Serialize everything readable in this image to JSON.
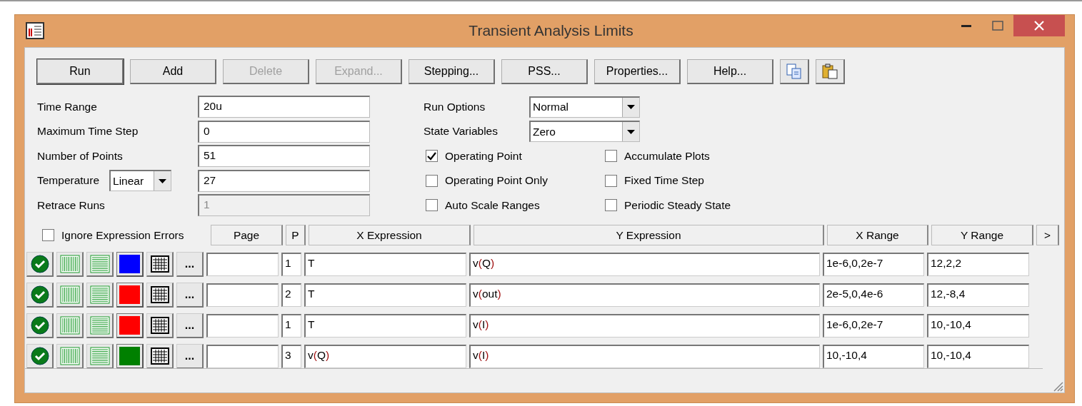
{
  "window": {
    "title": "Transient Analysis Limits"
  },
  "buttons": [
    {
      "label": "Run",
      "disabled": false,
      "default": true
    },
    {
      "label": "Add",
      "disabled": false,
      "default": false
    },
    {
      "label": "Delete",
      "disabled": true,
      "default": false
    },
    {
      "label": "Expand...",
      "disabled": true,
      "default": false
    },
    {
      "label": "Stepping...",
      "disabled": false,
      "default": false
    },
    {
      "label": "PSS...",
      "disabled": false,
      "default": false
    },
    {
      "label": "Properties...",
      "disabled": false,
      "default": false
    },
    {
      "label": "Help...",
      "disabled": false,
      "default": false
    }
  ],
  "fields": [
    {
      "label": "Time Range",
      "value": "20u",
      "disabled": false
    },
    {
      "label": "Maximum Time Step",
      "value": "0",
      "disabled": false
    },
    {
      "label": "Number of Points",
      "value": "51",
      "disabled": false
    },
    {
      "label": "Temperature",
      "value": "27",
      "disabled": false,
      "mode": "Linear"
    },
    {
      "label": "Retrace Runs",
      "value": "1",
      "disabled": true
    }
  ],
  "dropdowns": [
    {
      "label": "Run Options",
      "value": "Normal"
    },
    {
      "label": "State Variables",
      "value": "Zero"
    }
  ],
  "options": [
    {
      "label": "Operating Point",
      "checked": true
    },
    {
      "label": "Accumulate Plots",
      "checked": false
    },
    {
      "label": "Operating Point Only",
      "checked": false
    },
    {
      "label": "Fixed Time Step",
      "checked": false
    },
    {
      "label": "Auto Scale Ranges",
      "checked": false
    },
    {
      "label": "Periodic Steady State",
      "checked": false
    }
  ],
  "ignore_expression_errors": {
    "label": "Ignore Expression Errors",
    "checked": false
  },
  "table": {
    "columns": [
      "Page",
      "P",
      "X Expression",
      "Y Expression",
      "X Range",
      "Y Range"
    ],
    "more": ">",
    "rows": [
      {
        "color": "#0000ff",
        "page_button": "...",
        "p": "1",
        "x_expression": "T",
        "y_expression": "v(Q)",
        "x_range": "1e-6,0,2e-7",
        "y_range": "12,2,2"
      },
      {
        "color": "#ff0000",
        "page_button": "...",
        "p": "2",
        "x_expression": "T",
        "y_expression": "v(out)",
        "x_range": "2e-5,0,4e-6",
        "y_range": "12,-8,4"
      },
      {
        "color": "#ff0000",
        "page_button": "...",
        "p": "1",
        "x_expression": "T",
        "y_expression": "v(I)",
        "x_range": "1e-6,0,2e-7",
        "y_range": "10,-10,4"
      },
      {
        "color": "#008000",
        "page_button": "...",
        "p": "3",
        "x_expression": "v(Q)",
        "y_expression": "v(I)",
        "x_range": "10,-10,4",
        "y_range": "10,-10,4"
      }
    ]
  }
}
